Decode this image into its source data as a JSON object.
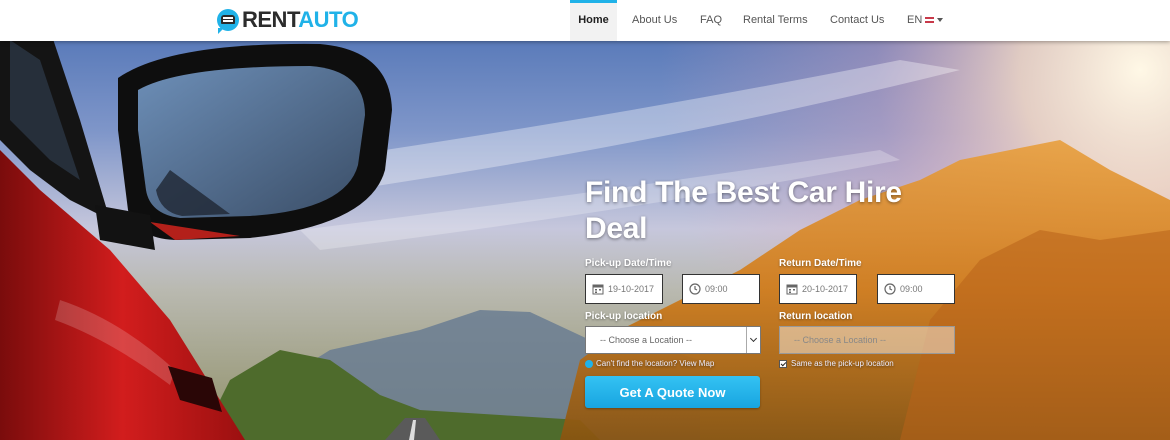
{
  "logo": {
    "rent": "RENT",
    "auto": "AUTO"
  },
  "nav": {
    "items": [
      {
        "label": "Home",
        "active": true
      },
      {
        "label": "About Us",
        "active": false
      },
      {
        "label": "FAQ",
        "active": false
      },
      {
        "label": "Rental Terms",
        "active": false
      },
      {
        "label": "Contact Us",
        "active": false
      }
    ],
    "language": "EN"
  },
  "hero": {
    "title": "Find The Best Car Hire Deal"
  },
  "form": {
    "pickup_datetime_label": "Pick-up Date/Time",
    "return_datetime_label": "Return Date/Time",
    "pickup_date": "19-10-2017",
    "pickup_time": "09:00",
    "return_date": "20-10-2017",
    "return_time": "09:00",
    "pickup_location_label": "Pick-up location",
    "return_location_label": "Return location",
    "pickup_location_value": "-- Choose a Location --",
    "return_location_value": "-- Choose a Location --",
    "cant_find_text": "Can't find the location? View Map",
    "same_as_pickup_text": "Same as the pick-up location",
    "same_as_pickup_checked": true,
    "submit_label": "Get A Quote Now"
  },
  "colors": {
    "accent": "#20b2e8",
    "button": "#20b2e8"
  },
  "icons": [
    "calendar-icon",
    "clock-icon",
    "chevron-down-icon",
    "uk-flag-icon"
  ]
}
